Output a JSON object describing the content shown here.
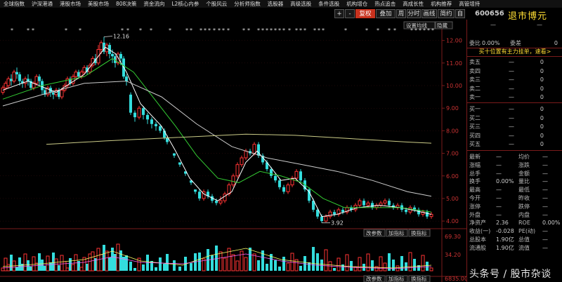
{
  "menubar": {
    "items": [
      "全球指数",
      "沪深港通",
      "港股市场",
      "美股市场",
      "808决策",
      "资金流向",
      "L2核心内参",
      "个股风云",
      "分析师指数",
      "选股器",
      "高级选股",
      "条件选股",
      "机构增仓",
      "热点追击",
      "高成长性",
      "机构推荐",
      "高管增持"
    ]
  },
  "toolbar": {
    "add_label": "+",
    "minus_label": "-",
    "rights_label": "复权",
    "overlay_label": "叠加",
    "period_label": "周",
    "minute_label": "分时",
    "draw_label": "画线",
    "indicator_label": "简约",
    "mode_label": "自",
    "settings_label": "设置均线",
    "hide_label": "隐藏"
  },
  "stock": {
    "code": "600656",
    "name": "退市博元"
  },
  "quote": {
    "price_dash": "—",
    "change_dash": "—",
    "ratio_label": "委比",
    "ratio_value": "0.00%",
    "diff_label": "委差",
    "diff_value": "0",
    "ad_text": "买十位置有主力挂单，速看>"
  },
  "orderbook": {
    "asks": [
      {
        "label": "卖五",
        "price": "—",
        "vol": "0"
      },
      {
        "label": "卖四",
        "price": "—",
        "vol": "0"
      },
      {
        "label": "卖三",
        "price": "—",
        "vol": "0"
      },
      {
        "label": "卖二",
        "price": "—",
        "vol": "0"
      },
      {
        "label": "卖一",
        "price": "—",
        "vol": "0"
      }
    ],
    "bids": [
      {
        "label": "买一",
        "price": "—",
        "vol": "0"
      },
      {
        "label": "买二",
        "price": "—",
        "vol": "0"
      },
      {
        "label": "买三",
        "price": "—",
        "vol": "0"
      },
      {
        "label": "买四",
        "price": "—",
        "vol": "0"
      },
      {
        "label": "买五",
        "price": "—",
        "vol": "0"
      }
    ]
  },
  "info": [
    {
      "l1": "最新",
      "v1": "—",
      "l2": "均价",
      "v2": "—"
    },
    {
      "l1": "涨幅",
      "v1": "—",
      "l2": "涨跌",
      "v2": "—"
    },
    {
      "l1": "总手",
      "v1": "—",
      "l2": "金额",
      "v2": "—"
    },
    {
      "l1": "换手",
      "v1": "0.00%",
      "l2": "量比",
      "v2": "—"
    },
    {
      "l1": "最高",
      "v1": "—",
      "l2": "最低",
      "v2": "—"
    },
    {
      "l1": "今开",
      "v1": "—",
      "l2": "昨收",
      "v2": "—"
    },
    {
      "l1": "涨停",
      "v1": "—",
      "l2": "跌停",
      "v2": "—"
    },
    {
      "l1": "外盘",
      "v1": "—",
      "l2": "内盘",
      "v2": "—"
    },
    {
      "l1": "净资产",
      "v1": "2.36",
      "l2": "ROE",
      "v2": "0.00%"
    },
    {
      "l1": "收益(一)",
      "v1": "-0.028",
      "l2": "PE(动)",
      "v2": "—"
    },
    {
      "l1": "总股本",
      "v1": "1.90亿",
      "l2": "总值",
      "v2": "—"
    },
    {
      "l1": "流通股",
      "v1": "1.90亿",
      "l2": "流值",
      "v2": "—"
    }
  ],
  "chart": {
    "price_ticks": [
      "12.00",
      "11.00",
      "10.00",
      "9.00",
      "8.00",
      "7.00",
      "6.00",
      "5.00",
      "4.00"
    ],
    "high_label": "12.16",
    "low_label": "3.92",
    "sub_buttons": [
      "改参数",
      "加指标",
      "换指标"
    ],
    "vol_ticks": [
      "69.30",
      "34.20",
      "6835.00"
    ],
    "colors": {
      "up": "#ff3333",
      "down": "#33dddd",
      "ma5": "#ffffff",
      "ma10": "#ffff66",
      "ma20": "#33cc33",
      "ma60": "#cccccc",
      "ma120": "#cccc88"
    }
  },
  "watermark": "头条号 / 股市杂谈"
}
